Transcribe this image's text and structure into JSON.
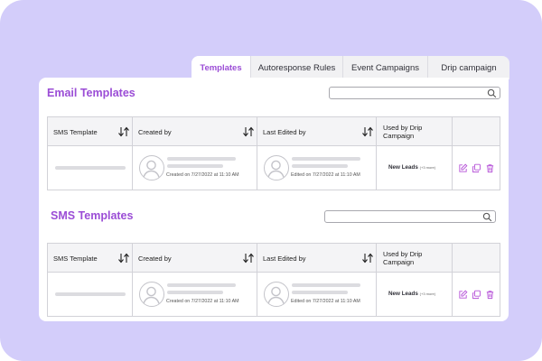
{
  "tabs": [
    {
      "label": "Templates",
      "active": true
    },
    {
      "label": "Autoresponse Rules",
      "active": false
    },
    {
      "label": "Event Campaigns",
      "active": false
    },
    {
      "label": "Drip campaign",
      "active": false
    }
  ],
  "email_section": {
    "title": "Email Templates",
    "search_value": "",
    "headers": {
      "template": "SMS Template",
      "created_by": "Created by",
      "last_edited_by": "Last Edited by",
      "used_by": "Used by Drip Campaign"
    },
    "row": {
      "created_meta": "Created on 7/27/2022 at 11:10 AM",
      "edited_meta": "Edited on 7/27/2022 at 11:10 AM",
      "used_by": "New Leads",
      "used_by_more": "(+3 more)"
    }
  },
  "sms_section": {
    "title": "SMS Templates",
    "search_value": "",
    "headers": {
      "template": "SMS Template",
      "created_by": "Created by",
      "last_edited_by": "Last Edited by",
      "used_by": "Used by Drip Campaign"
    },
    "row": {
      "created_meta": "Created on 7/27/2022 at 11:10 AM",
      "edited_meta": "Edited on 7/27/2022 at 11:10 AM",
      "used_by": "New Leads",
      "used_by_more": "(+3 more)"
    }
  },
  "icons": {
    "search": "search-icon",
    "sort": "sort-arrows-icon",
    "avatar": "user-avatar-icon",
    "edit": "edit-icon",
    "duplicate": "copy-icon",
    "delete": "trash-icon"
  },
  "colors": {
    "accent": "#9b4dd6",
    "background": "#d3cdfa",
    "placeholder": "#dcdce0",
    "icon": "#b653d8"
  }
}
